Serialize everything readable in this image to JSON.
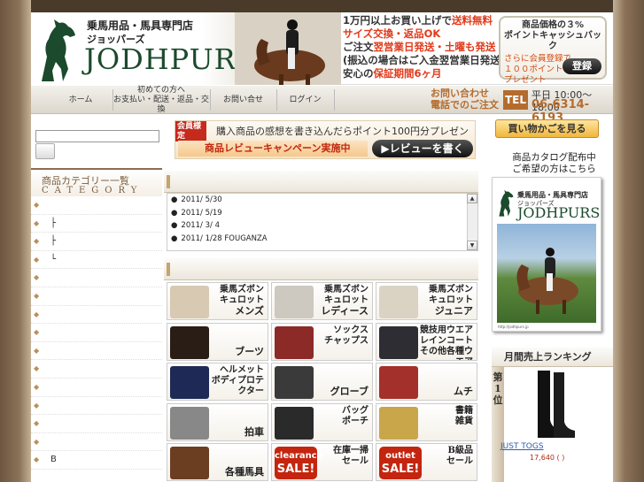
{
  "header": {
    "shop_sub": "乗馬用品・馬具専門店",
    "shop_kana": "ジョッパーズ",
    "shop_name": "JODHPURS",
    "promo": [
      {
        "text": "1万円以上お買い上げで",
        "highlight": "送料無料"
      },
      {
        "text": "",
        "highlight": "サイズ交換・返品OK"
      },
      {
        "text": "ご注文",
        "highlight": "翌営業日発送・土曜も発送"
      },
      {
        "text": "(振込の場合はご入金翌営業日発送)",
        "highlight": ""
      },
      {
        "text": "安心の",
        "highlight": "保証期間6ヶ月"
      }
    ],
    "point_box": {
      "title": "商品価格の３%\nポイントキャッシュバック",
      "sub": "さらに会員登録で\n１００ポイント\nプレゼント",
      "button": "登録"
    }
  },
  "nav": {
    "items": [
      "ホーム",
      "初めての方へ\nお支払い・配送・返品・交換",
      "お問い合せ",
      "ログイン"
    ],
    "contact_label": "お問い合わせ\n電話でのご注文",
    "tel_badge": "TEL",
    "hours": "平日 10:00〜18:00",
    "tel": "06-6314-6193"
  },
  "category": {
    "title_jp": "商品カテゴリー一覧",
    "title_en": "CATEGORY",
    "items": [
      "",
      "├",
      "├",
      "└",
      "",
      "",
      "",
      "",
      "",
      "",
      "",
      "",
      "",
      "",
      "B"
    ]
  },
  "review": {
    "member_tag": "会員様\n定",
    "line1": "購入商品の感想を書き込んだらポイント100円分プレゼント",
    "line2": "商品レビューキャンペーン実施中",
    "button": "▶レビューを書く"
  },
  "news": [
    {
      "date": "2011/ 5/30",
      "text": ""
    },
    {
      "date": "2011/ 5/19",
      "text": ""
    },
    {
      "date": "2011/ 3/ 4",
      "text": ""
    },
    {
      "date": "2011/ 1/28",
      "text": "FOUGANZA"
    }
  ],
  "tiles": [
    {
      "label": "乗馬ズボン\nキュロット",
      "sub": "メンズ",
      "color": "#d7c9b2"
    },
    {
      "label": "乗馬ズボン\nキュロット",
      "sub": "レディース",
      "color": "#cdc8c0"
    },
    {
      "label": "乗馬ズボン\nキュロット",
      "sub": "ジュニア",
      "color": "#dad3c4"
    },
    {
      "label": "",
      "sub": "ブーツ",
      "color": "#2a1d15"
    },
    {
      "label": "ソックス\nチャップス",
      "sub": "",
      "color": "#8c2a28"
    },
    {
      "label": "競技用ウエア\nレインコート\nその他各種ウエア",
      "sub": "",
      "color": "#2d2d33"
    },
    {
      "label": "ヘルメット\nボディプロテクター",
      "sub": "",
      "color": "#1e2a55"
    },
    {
      "label": "",
      "sub": "グローブ",
      "color": "#3a3a3a"
    },
    {
      "label": "",
      "sub": "ムチ",
      "color": "#a3302a"
    },
    {
      "label": "",
      "sub": "拍車",
      "color": "#888888"
    },
    {
      "label": "バッグ\nポーチ",
      "sub": "",
      "color": "#2a2a2a"
    },
    {
      "label": "書籍\n雑貨",
      "sub": "",
      "color": "#c9a64a"
    },
    {
      "label": "",
      "sub": "各種馬具",
      "color": "#6b3e22"
    },
    {
      "label": "在庫一掃\nセール",
      "sub": "",
      "sale": [
        "clearance",
        "SALE!"
      ]
    },
    {
      "label": "B級品\nセール",
      "sub": "",
      "sale": [
        "outlet",
        "SALE!"
      ]
    }
  ],
  "right": {
    "cart_button": "買い物かごを見る",
    "catalog_label": "商品カタログ配布中\nご希望の方はこちら",
    "catalog_shop1": "乗馬用品・馬具専門店",
    "catalog_shop2": "ジョッパーズ",
    "catalog_name": "JODHPURS",
    "catalog_url": "http://jodhpurs.jp",
    "ranking_title": "月間売上ランキング",
    "rank_num": "第\n1\n位",
    "rank_item": "JUST TOGS",
    "rank_price": "17,640 ( )"
  },
  "colors": {
    "accent": "#b46c2e",
    "red": "#e03a1a",
    "brand_green": "#1b4a2c"
  }
}
